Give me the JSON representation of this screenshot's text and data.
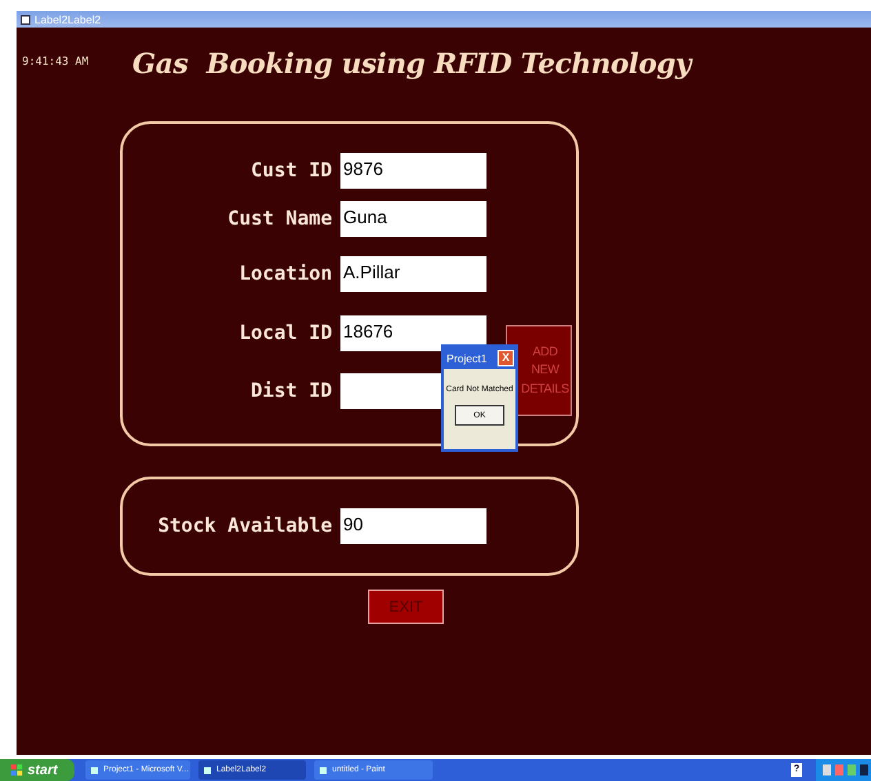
{
  "window": {
    "title": "Label2Label2"
  },
  "clock": "9:41:43 AM",
  "heading": "Gas  Booking using RFID Technology",
  "customer_form": {
    "fields": [
      {
        "label": "Cust ID",
        "value": "9876"
      },
      {
        "label": "Cust Name",
        "value": "Guna"
      },
      {
        "label": "Location",
        "value": "A.Pillar"
      },
      {
        "label": "Local ID",
        "value": "18676"
      },
      {
        "label": "Dist ID"
      }
    ],
    "add_button": "ADD NEW DETAILS"
  },
  "stock": {
    "label": "Stock Available",
    "value": "90"
  },
  "exit_button": "EXIT",
  "dialog": {
    "title": "Project1",
    "close": "X",
    "message": "Card Not Matched",
    "ok": "OK"
  },
  "taskbar": {
    "start": "start",
    "tasks": [
      {
        "label": "Project1 - Microsoft V...",
        "selected": false
      },
      {
        "label": "Label2Label2",
        "selected": true
      },
      {
        "label": "untitled - Paint",
        "selected": false
      }
    ],
    "help": "?"
  }
}
